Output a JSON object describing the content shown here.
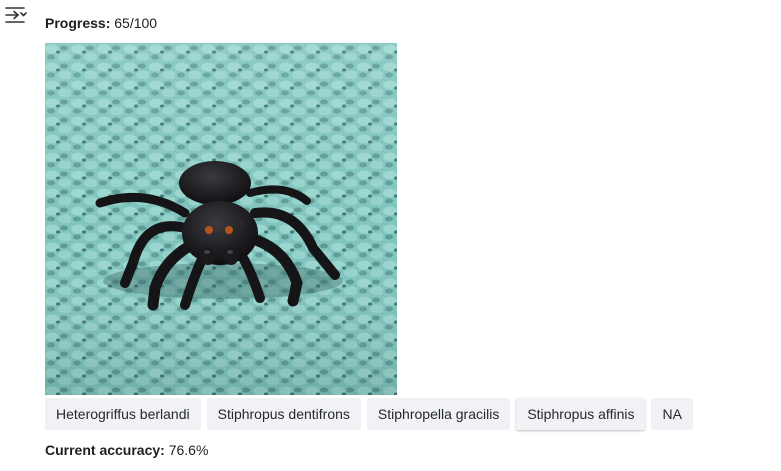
{
  "progress": {
    "label": "Progress:",
    "value": "65/100"
  },
  "image": {
    "subject": "black jumping spider on teal textured fabric"
  },
  "choices": [
    {
      "label": "Heterogriffus berlandi"
    },
    {
      "label": "Stiphropus dentifrons"
    },
    {
      "label": "Stiphropella gracilis"
    },
    {
      "label": "Stiphropus affinis"
    },
    {
      "label": "NA"
    }
  ],
  "accuracy": {
    "label": "Current accuracy:",
    "value": "76.6%"
  },
  "icons": {
    "sidebar_toggle": "collapse-sidebar-icon"
  },
  "colors": {
    "button_bg": "#f0f2f6",
    "text": "#262730",
    "background": "#ffffff"
  }
}
